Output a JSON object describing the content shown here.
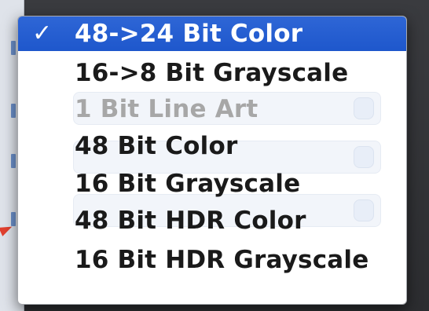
{
  "menu": {
    "selected_mark": "✓",
    "items": [
      {
        "label": "48->24 Bit Color",
        "selected": true,
        "disabled": false
      },
      {
        "label": "16->8 Bit Grayscale",
        "selected": false,
        "disabled": false
      },
      {
        "label": "1 Bit Line Art",
        "selected": false,
        "disabled": true
      },
      {
        "label": "48 Bit Color",
        "selected": false,
        "disabled": false
      },
      {
        "label": "16 Bit Grayscale",
        "selected": false,
        "disabled": false
      },
      {
        "label": "48 Bit HDR Color",
        "selected": false,
        "disabled": false
      },
      {
        "label": "16 Bit HDR Grayscale",
        "selected": false,
        "disabled": false
      }
    ]
  },
  "colors": {
    "selection": "#2e66d6",
    "disabled_text": "#a7a7a7",
    "arrow_accent": "#e1402f"
  }
}
